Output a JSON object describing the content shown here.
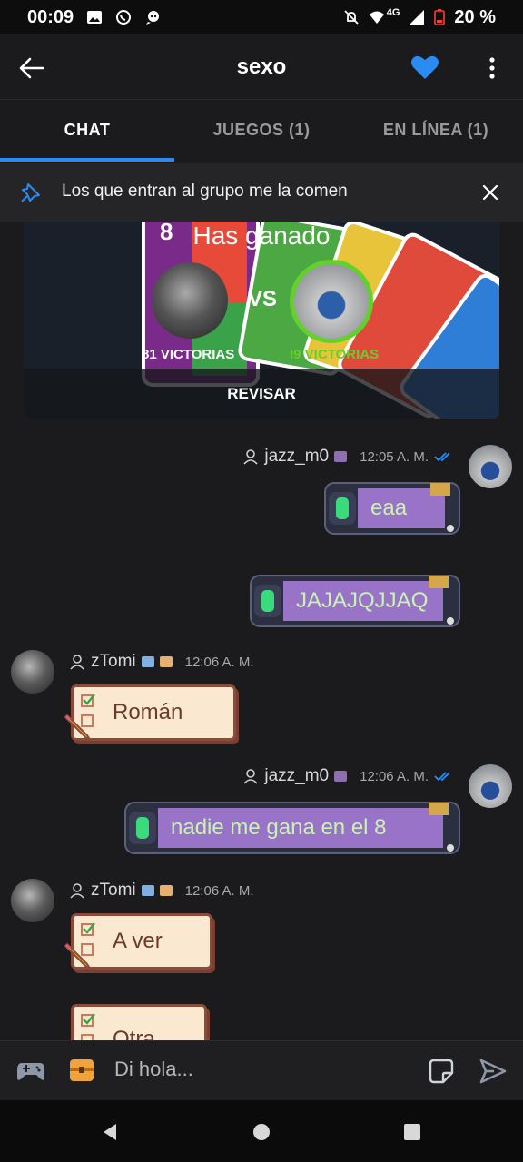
{
  "status": {
    "time": "00:09",
    "network": "4G",
    "battery": "20 %"
  },
  "header": {
    "title": "sexo"
  },
  "tabs": [
    {
      "label": "CHAT"
    },
    {
      "label": "JUEGOS (1)"
    },
    {
      "label": "EN LÍNEA (1)"
    }
  ],
  "pinned": {
    "text": "Los que entran al grupo me la comen"
  },
  "game_result": {
    "heading": "Has ganado",
    "vs": "VS",
    "player_a_wins": "81 VICTORIAS",
    "player_b_wins": "I9 VICTORIAS",
    "action": "REVISAR"
  },
  "messages": [
    {
      "user": "jazz_m0",
      "time": "12:05 A. M.",
      "texts": [
        "eaa",
        "JAJAJQJJAQ"
      ]
    },
    {
      "user": "zTomi",
      "time": "12:06 A. M.",
      "texts": [
        "Román"
      ]
    },
    {
      "user": "jazz_m0",
      "time": "12:06 A. M.",
      "texts": [
        "nadie me gana en el 8"
      ]
    },
    {
      "user": "zTomi",
      "time": "12:06 A. M.",
      "texts": [
        "A ver",
        "Otra"
      ]
    }
  ],
  "composer": {
    "placeholder": "Di hola..."
  },
  "colors": {
    "accent": "#2a8bf2",
    "win_green": "#63d12b",
    "heart": "#2a8bf2"
  }
}
